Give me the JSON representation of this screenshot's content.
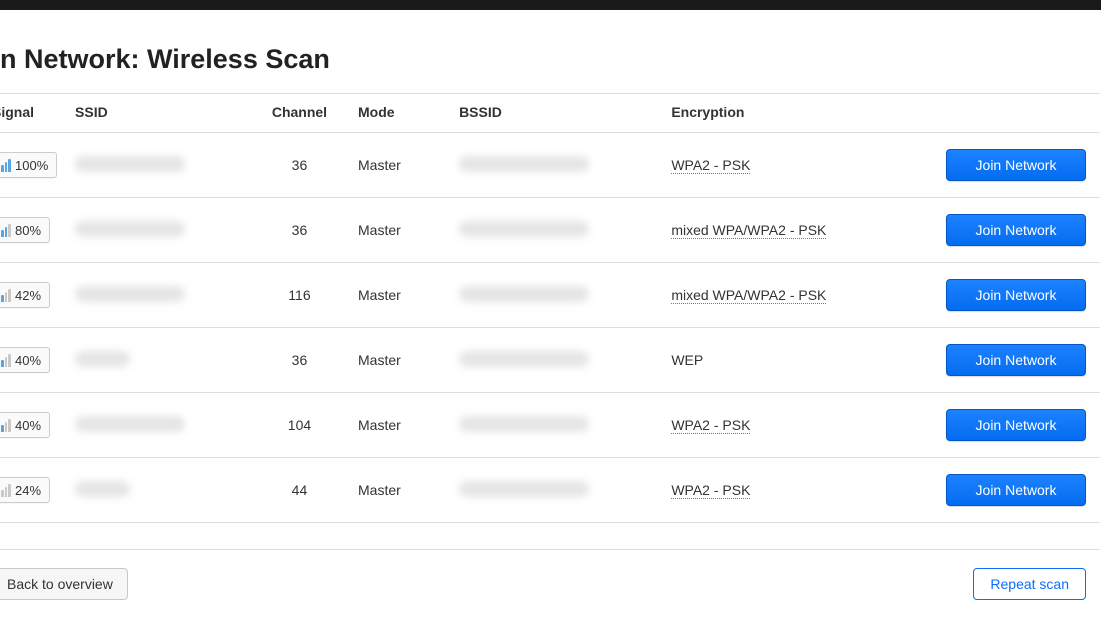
{
  "title": "n Network: Wireless Scan",
  "headers": {
    "signal": "Signal",
    "ssid": "SSID",
    "channel": "Channel",
    "mode": "Mode",
    "bssid": "BSSID",
    "encryption": "Encryption"
  },
  "actions": {
    "join": "Join Network",
    "back": "Back to overview",
    "repeat": "Repeat scan"
  },
  "networks": [
    {
      "signal_pct": "100%",
      "signal_level": 4,
      "ssid": null,
      "ssid_narrow": false,
      "channel": "36",
      "mode": "Master",
      "bssid": null,
      "encryption": "WPA2 - PSK",
      "encryption_link": true
    },
    {
      "signal_pct": "80%",
      "signal_level": 3,
      "ssid": null,
      "ssid_narrow": false,
      "channel": "36",
      "mode": "Master",
      "bssid": null,
      "encryption": "mixed WPA/WPA2 - PSK",
      "encryption_link": true
    },
    {
      "signal_pct": "42%",
      "signal_level": 2,
      "ssid": null,
      "ssid_narrow": false,
      "channel": "116",
      "mode": "Master",
      "bssid": null,
      "encryption": "mixed WPA/WPA2 - PSK",
      "encryption_link": true
    },
    {
      "signal_pct": "40%",
      "signal_level": 2,
      "ssid": null,
      "ssid_narrow": true,
      "channel": "36",
      "mode": "Master",
      "bssid": null,
      "encryption": "WEP",
      "encryption_link": false
    },
    {
      "signal_pct": "40%",
      "signal_level": 2,
      "ssid": null,
      "ssid_narrow": false,
      "channel": "104",
      "mode": "Master",
      "bssid": null,
      "encryption": "WPA2 - PSK",
      "encryption_link": true
    },
    {
      "signal_pct": "24%",
      "signal_level": 1,
      "ssid": null,
      "ssid_narrow": true,
      "channel": "44",
      "mode": "Master",
      "bssid": null,
      "encryption": "WPA2 - PSK",
      "encryption_link": true
    }
  ]
}
